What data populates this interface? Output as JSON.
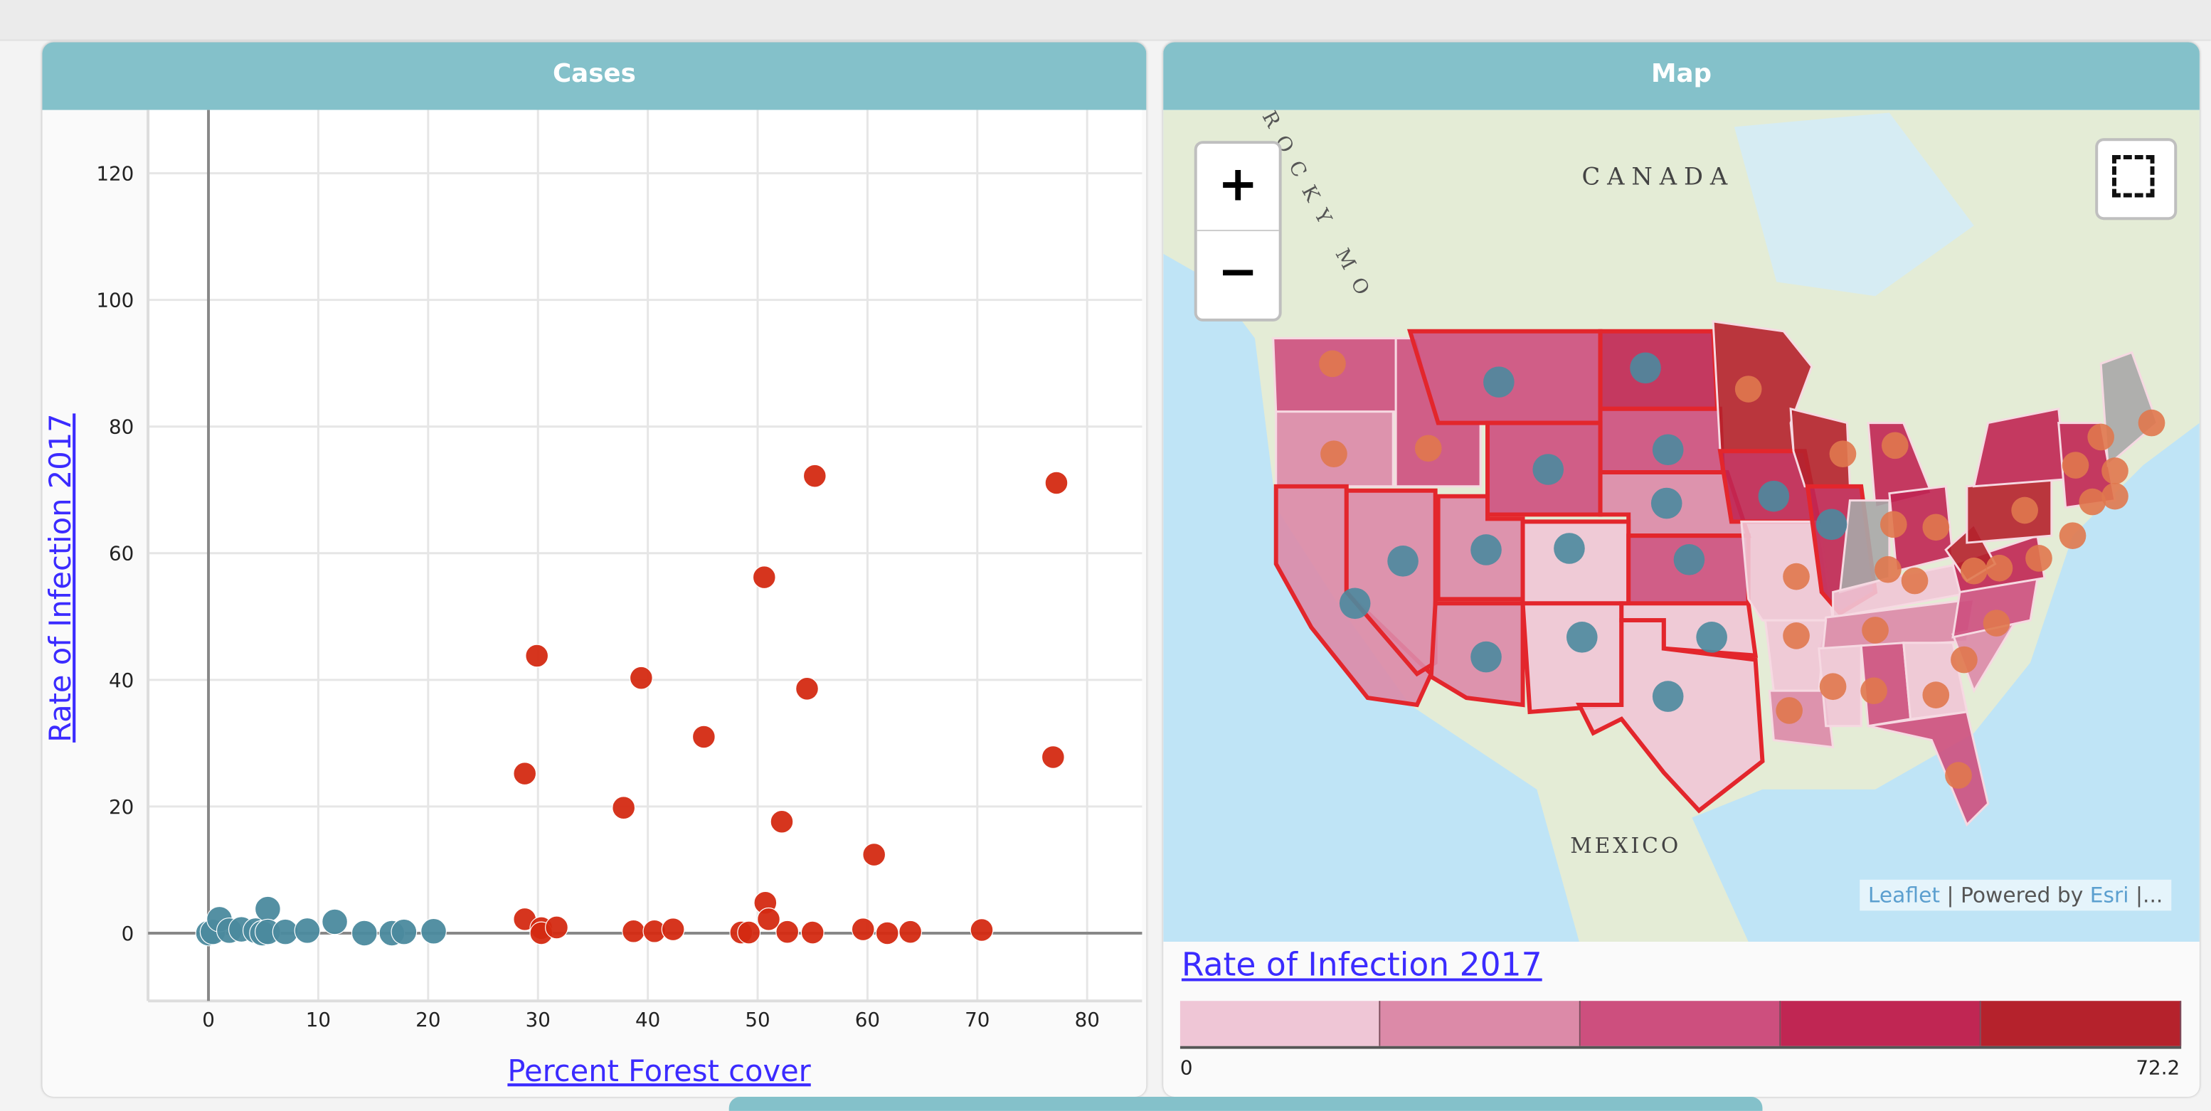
{
  "panels": {
    "cases_title": "Cases",
    "map_title": "Map"
  },
  "colors": {
    "header": "#84c1ca",
    "low_forest": "#4b8a9e",
    "high_forest": "#d42a12",
    "state_point_east": "#e0784e",
    "no_data": "#a9a9a9"
  },
  "chart_data": {
    "type": "scatter",
    "title": "",
    "xlabel": "Percent Forest cover",
    "ylabel": "Rate of Infection 2017",
    "xlim": [
      -5.5,
      85
    ],
    "ylim": [
      -10.7,
      130
    ],
    "xticks": [
      0,
      10,
      20,
      30,
      40,
      50,
      60,
      70,
      80
    ],
    "yticks": [
      0,
      20,
      40,
      60,
      80,
      100,
      120
    ],
    "grid": true,
    "series": [
      {
        "color": "#4b8a9e",
        "points": [
          [
            0,
            0
          ],
          [
            0.4,
            0.2
          ],
          [
            1,
            2.2
          ],
          [
            1.9,
            0.4
          ],
          [
            3,
            0.6
          ],
          [
            4.3,
            0.4
          ],
          [
            4.9,
            0
          ],
          [
            5.4,
            3.8
          ],
          [
            5.4,
            0.2
          ],
          [
            7,
            0.2
          ],
          [
            9,
            0.4
          ],
          [
            11.5,
            1.8
          ],
          [
            14.2,
            0
          ],
          [
            16.7,
            0
          ],
          [
            17.8,
            0.2
          ],
          [
            20.5,
            0.3
          ]
        ]
      },
      {
        "color": "#d42a12",
        "points": [
          [
            55.2,
            72.2
          ],
          [
            77.2,
            71.1
          ],
          [
            50.6,
            56.2
          ],
          [
            29.9,
            43.8
          ],
          [
            39.4,
            40.3
          ],
          [
            54.5,
            38.6
          ],
          [
            45.1,
            31.0
          ],
          [
            28.8,
            25.2
          ],
          [
            76.9,
            27.8
          ],
          [
            37.8,
            19.8
          ],
          [
            52.2,
            17.6
          ],
          [
            60.6,
            12.4
          ],
          [
            50.7,
            4.8
          ],
          [
            51.0,
            2.2
          ],
          [
            28.8,
            2.2
          ],
          [
            30.3,
            0.8
          ],
          [
            30.3,
            0
          ],
          [
            31.7,
            0.9
          ],
          [
            38.7,
            0.3
          ],
          [
            40.6,
            0.3
          ],
          [
            42.3,
            0.6
          ],
          [
            48.5,
            0.1
          ],
          [
            49.2,
            0.1
          ],
          [
            52.7,
            0.2
          ],
          [
            55,
            0.1
          ],
          [
            59.6,
            0.6
          ],
          [
            61.8,
            0
          ],
          [
            63.9,
            0.2
          ],
          [
            70.4,
            0.5
          ]
        ]
      }
    ]
  },
  "map": {
    "labels": {
      "canada": "CANADA",
      "mexico": "MEXICO",
      "rocky": "ROCKY MO"
    },
    "zoom_in": "+",
    "zoom_out": "−",
    "attribution": {
      "leaflet": "Leaflet",
      "sep": " | Powered by ",
      "esri": "Esri",
      "more": " |..."
    },
    "select_icon": "dashed-rectangle-select-icon"
  },
  "legend": {
    "title": "Rate of Infection 2017",
    "min": "0",
    "max": "72.2",
    "classes": [
      "#efc6d6",
      "#dc8aa8",
      "#cd4f7e",
      "#c02653",
      "#b5222c"
    ]
  }
}
